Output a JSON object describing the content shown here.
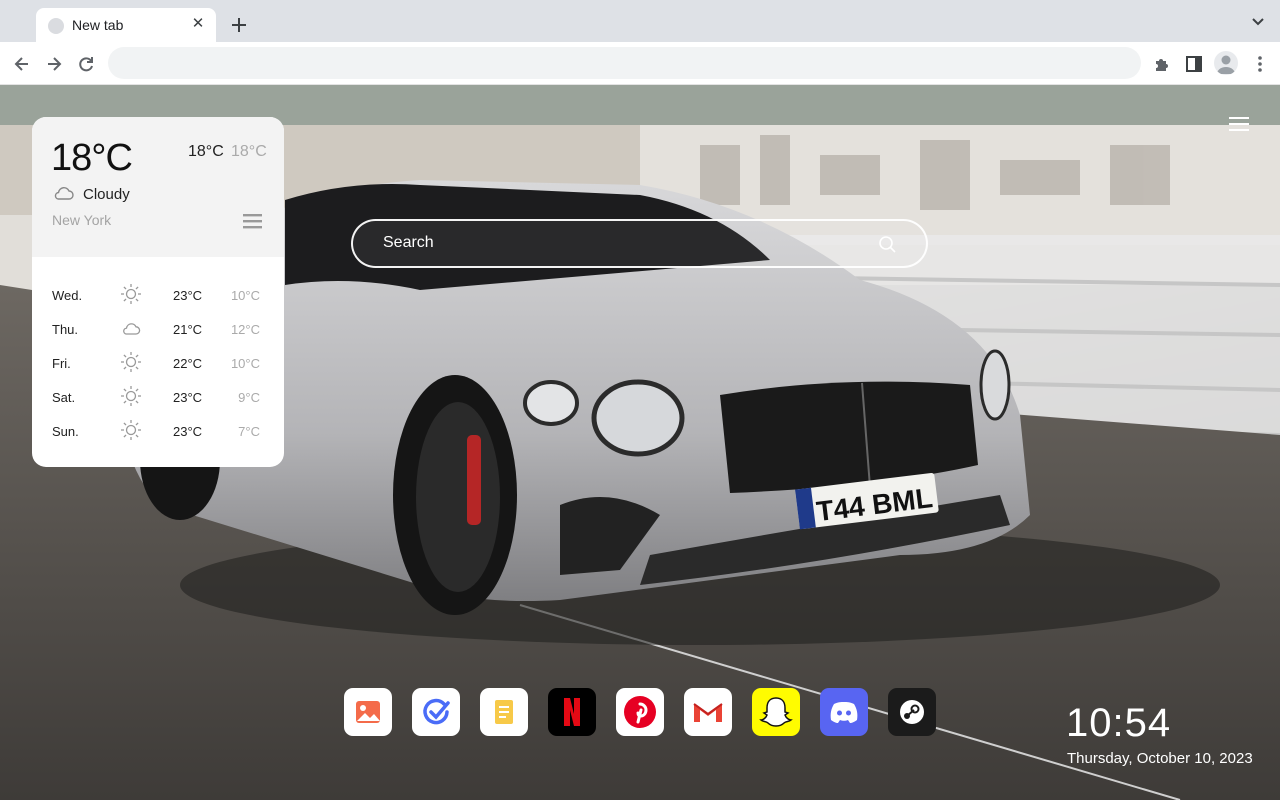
{
  "browser": {
    "tab": {
      "title": "New tab"
    },
    "omnibox": {
      "value": ""
    }
  },
  "icons": {
    "back": "arrow-left-icon",
    "forward": "arrow-right-icon",
    "reload": "reload-icon",
    "extensions": "puzzle-icon",
    "sidepanel": "side-panel-icon",
    "profile": "avatar-icon",
    "menu": "three-dot-menu-icon"
  },
  "weather": {
    "current_temp": "18°C",
    "high": "18°C",
    "low": "18°C",
    "condition": "Cloudy",
    "condition_icon": "cloud-icon",
    "city": "New York",
    "forecast": [
      {
        "day": "Wed.",
        "icon": "sun-icon",
        "high": "23°C",
        "low": "10°C"
      },
      {
        "day": "Thu.",
        "icon": "cloud-icon",
        "high": "21°C",
        "low": "12°C"
      },
      {
        "day": "Fri.",
        "icon": "sun-icon",
        "high": "22°C",
        "low": "10°C"
      },
      {
        "day": "Sat.",
        "icon": "sun-icon",
        "high": "23°C",
        "low": "9°C"
      },
      {
        "day": "Sun.",
        "icon": "sun-icon",
        "high": "23°C",
        "low": "7°C"
      }
    ]
  },
  "search": {
    "placeholder": "Search"
  },
  "dock": [
    {
      "name": "photos-app",
      "color": "#ffffff"
    },
    {
      "name": "check-app",
      "color": "#ffffff"
    },
    {
      "name": "notes-app",
      "color": "#ffffff"
    },
    {
      "name": "netflix-app",
      "color": "#000000"
    },
    {
      "name": "pinterest-app",
      "color": "#ffffff"
    },
    {
      "name": "gmail-app",
      "color": "#ffffff"
    },
    {
      "name": "snapchat-app",
      "color": "#fffc00"
    },
    {
      "name": "discord-app",
      "color": "#5865f2"
    },
    {
      "name": "steam-app",
      "color": "#1b1b1b"
    }
  ],
  "clock": {
    "time": "10:54",
    "date": "Thursday, October 10, 2023"
  },
  "background": {
    "plate_text": "T44 BML",
    "plate_region": "UK"
  }
}
